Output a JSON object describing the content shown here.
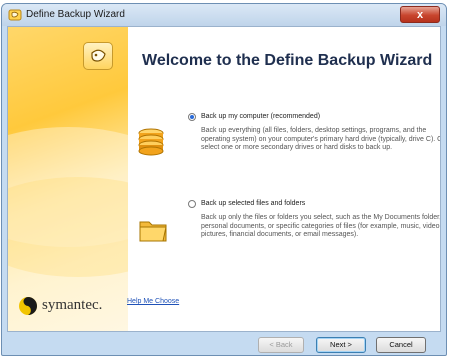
{
  "window": {
    "title": "Define Backup Wizard",
    "close_label": "x"
  },
  "brand": {
    "name": "symantec."
  },
  "main": {
    "heading": "Welcome to the Define Backup Wizard",
    "options": [
      {
        "label": "Back up my computer (recommended)",
        "selected": true,
        "description": "Back up everything (all files, folders, desktop settings, programs, and the operating system) on your computer's primary hard drive (typically, drive C). Or, select one or more secondary drives or hard disks to back up.",
        "icon": "database-icon"
      },
      {
        "label": "Back up selected files and folders",
        "selected": false,
        "description": "Back up only the files or folders you select, such as the My Documents folder, personal documents, or specific categories of files (for example, music, video, pictures, financial documents, or email messages).",
        "icon": "folder-icon"
      }
    ]
  },
  "footer": {
    "help_link": "Help Me Choose",
    "back_label": "< Back",
    "next_label": "Next >",
    "cancel_label": "Cancel"
  },
  "colors": {
    "accent": "#ffc93c",
    "titlebar": "#c5dbf1",
    "heading": "#1f2f4f",
    "link": "#1f52b8"
  }
}
